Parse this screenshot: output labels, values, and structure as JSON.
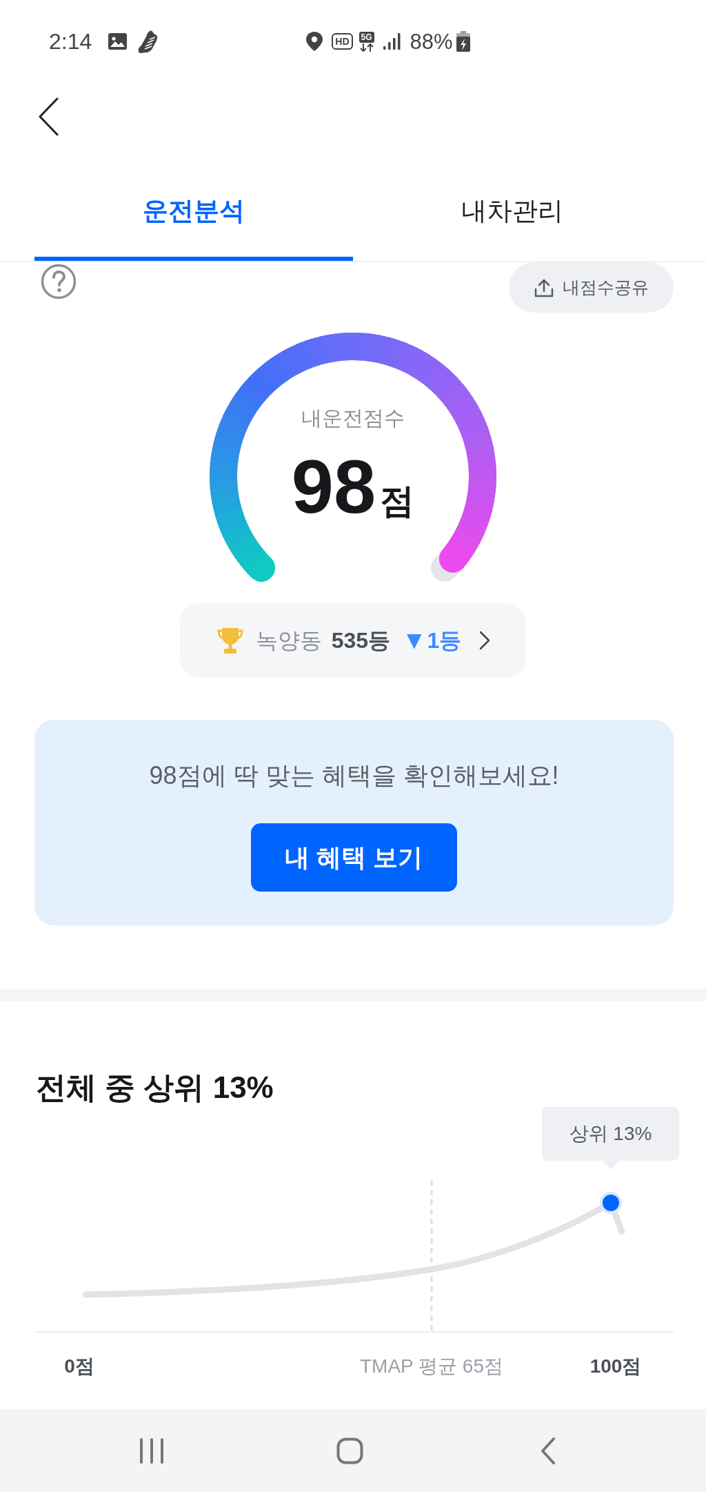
{
  "status_bar": {
    "time": "2:14",
    "hd_label": "HD",
    "network_type": "5G",
    "battery": "88%"
  },
  "tabs": [
    {
      "label": "운전분석",
      "selected": true
    },
    {
      "label": "내차관리",
      "selected": false
    }
  ],
  "share_button": {
    "label": "내점수공유"
  },
  "score": {
    "label": "내운전점수",
    "value": "98",
    "unit": "점",
    "level": 0.98
  },
  "rank": {
    "region": "녹양동",
    "rank": "535등",
    "change": {
      "arrow": "▼",
      "text": "1등"
    }
  },
  "benefit": {
    "message": "98점에 딱 맞는 혜택을 확인해보세요!",
    "button": "내 혜택 보기"
  },
  "distribution": {
    "title": "전체 중 상위 13%",
    "tooltip": "상위 13%",
    "axis_labels": [
      {
        "text": "0점",
        "kind": "bound"
      },
      {
        "text": "TMAP 평균 65점",
        "kind": "average"
      },
      {
        "text": "100점",
        "kind": "bound"
      }
    ]
  }
}
